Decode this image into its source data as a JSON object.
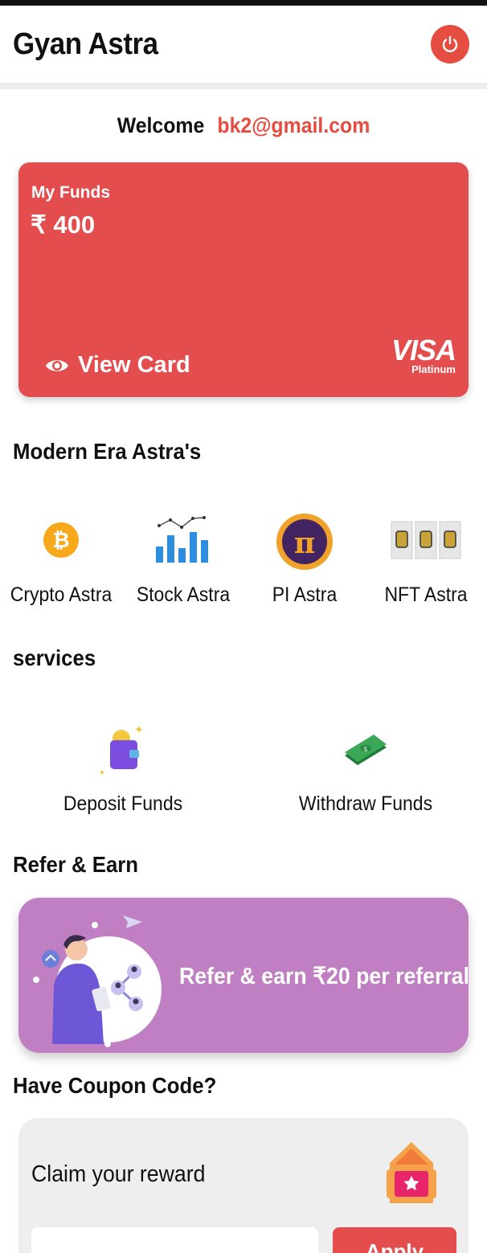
{
  "app": {
    "title": "Gyan Astra",
    "accent": "#e44d40"
  },
  "header": {
    "logout_icon": "power-icon"
  },
  "welcome": {
    "label": "Welcome",
    "email": "bk2@gmail.com"
  },
  "funds": {
    "label": "My Funds",
    "amount": "₹ 400",
    "view_card_label": "View Card",
    "card_brand": "VISA",
    "card_tier": "Platinum",
    "color": "#e44d4e"
  },
  "modern_section": {
    "title": "Modern Era Astra's",
    "items": [
      {
        "label": "Crypto Astra",
        "icon": "bitcoin-icon"
      },
      {
        "label": "Stock Astra",
        "icon": "bar-chart-icon"
      },
      {
        "label": "PI Astra",
        "icon": "pi-coin-icon"
      },
      {
        "label": "NFT Astra",
        "icon": "nft-icon"
      }
    ]
  },
  "services_section": {
    "title": "services",
    "items": [
      {
        "label": "Deposit Funds",
        "icon": "wallet-icon"
      },
      {
        "label": "Withdraw Funds",
        "icon": "cash-icon"
      }
    ]
  },
  "refer_section": {
    "title": "Refer & Earn",
    "banner_text": "Refer & earn ₹20 per referral",
    "color": "#c17fc3"
  },
  "coupon_section": {
    "title": "Have Coupon Code?",
    "card_title": "Claim your reward",
    "input_placeholder": "",
    "button_label": "Apply"
  }
}
